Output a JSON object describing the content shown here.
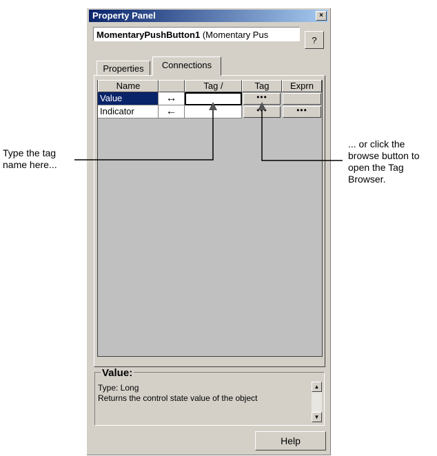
{
  "window": {
    "title": "Property Panel",
    "close_glyph": "×"
  },
  "object": {
    "name_bold": "MomentaryPushButton1",
    "name_rest": " (Momentary Pus",
    "help_glyph": "?"
  },
  "tabs": [
    {
      "label": "Properties"
    },
    {
      "label": "Connections"
    }
  ],
  "grid": {
    "columns": [
      "Name",
      "",
      "Tag /",
      "Tag",
      "Exprn"
    ],
    "rows": [
      {
        "name": "Value",
        "arrow": "↔",
        "tag": "",
        "browse": "•••",
        "exprn": ""
      },
      {
        "name": "Indicator",
        "arrow": "←",
        "tag": "",
        "browse": "•••",
        "exprn": "•••"
      }
    ]
  },
  "description": {
    "title": "Value:",
    "type_line": "Type: Long",
    "text_line": "Returns the control state value of the object",
    "scroll_up": "▲",
    "scroll_down": "▼"
  },
  "buttons": {
    "help": "Help"
  },
  "callouts": {
    "left": [
      "Type the tag",
      "name here..."
    ],
    "right": [
      "... or click the",
      "browse button to",
      "open the Tag",
      "Browser."
    ]
  },
  "colors": {
    "selection": "#0a246a",
    "titlebar_start": "#0a246a",
    "titlebar_end": "#a6caf0",
    "face": "#d4d0c8"
  }
}
